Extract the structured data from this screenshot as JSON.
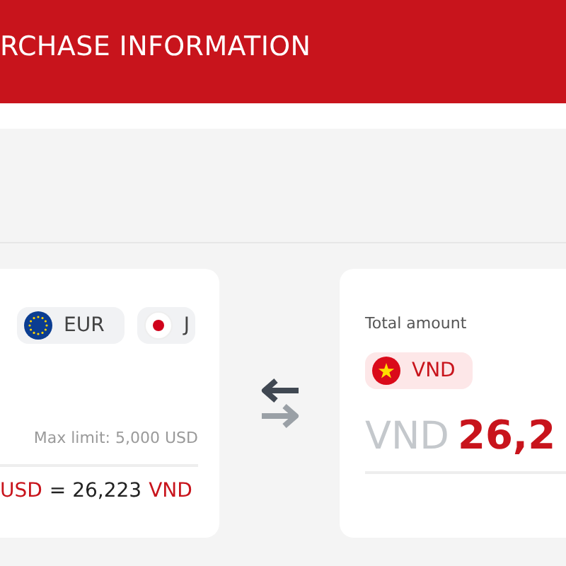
{
  "header": {
    "title": "RCHASE INFORMATION"
  },
  "from_card": {
    "currencies": [
      {
        "code": "EUR",
        "kind": "eu",
        "selected": false
      },
      {
        "code": "J",
        "kind": "jp",
        "selected": false
      }
    ],
    "max_limit": "Max limit: 5,000 USD",
    "rate": {
      "base": "USD",
      "value": "= 26,223",
      "quote": "VND"
    }
  },
  "to_card": {
    "label": "Total amount",
    "currency": {
      "code": "VND",
      "kind": "vn",
      "selected": true
    },
    "amount_prefix": "VND",
    "amount": "26,2"
  }
}
